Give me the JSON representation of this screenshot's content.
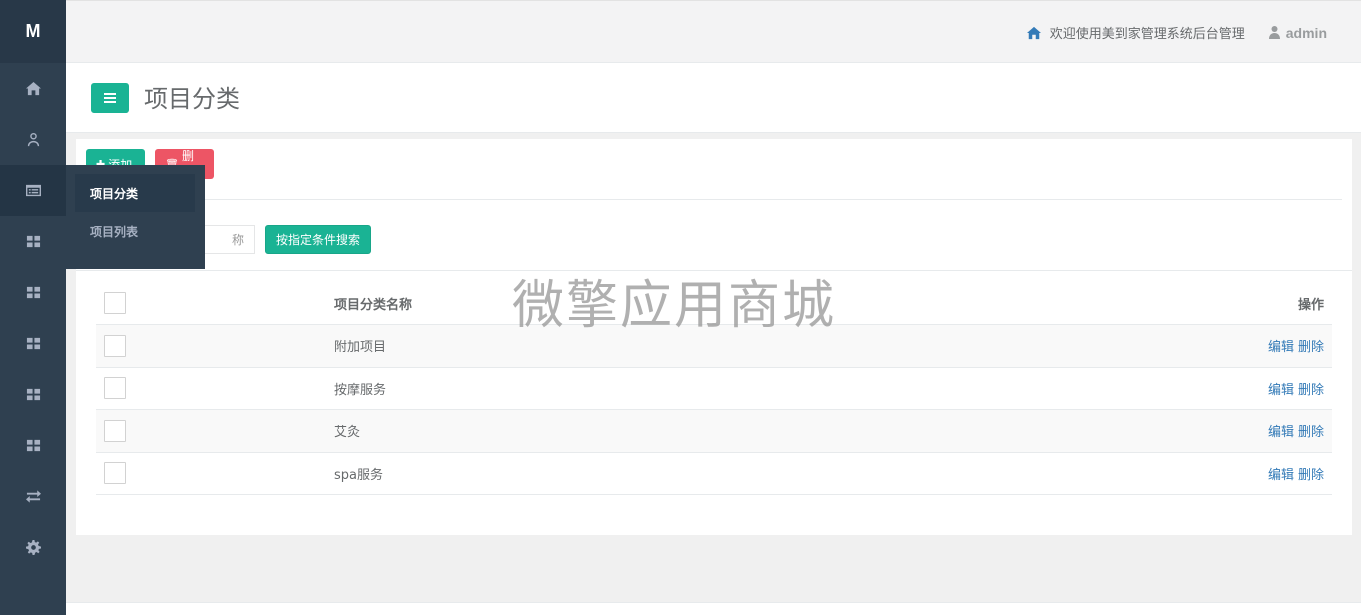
{
  "sidebar": {
    "logo": "M",
    "items": [
      {
        "icon": "home-icon"
      },
      {
        "icon": "user-icon"
      },
      {
        "icon": "list-icon",
        "active": true
      },
      {
        "icon": "grid-icon"
      },
      {
        "icon": "grid-icon"
      },
      {
        "icon": "grid-icon"
      },
      {
        "icon": "grid-icon"
      },
      {
        "icon": "grid-icon"
      },
      {
        "icon": "exchange-icon"
      },
      {
        "icon": "gear-icon"
      }
    ],
    "flyout": {
      "items": [
        {
          "label": "项目分类",
          "active": true
        },
        {
          "label": "项目列表"
        }
      ]
    }
  },
  "topbar": {
    "welcome": "欢迎使用美到家管理系统后台管理",
    "user": "admin"
  },
  "page": {
    "title": "项目分类"
  },
  "toolbar": {
    "add_label": "添加",
    "delete_label": "删除",
    "search_placeholder_visible": "称",
    "search_button": "按指定条件搜索"
  },
  "table": {
    "headers": {
      "name": "项目分类名称",
      "op": "操作"
    },
    "rows": [
      {
        "name": "附加项目",
        "edit": "编辑",
        "delete": "删除"
      },
      {
        "name": "按摩服务",
        "edit": "编辑",
        "delete": "删除"
      },
      {
        "name": "艾灸",
        "edit": "编辑",
        "delete": "删除"
      },
      {
        "name": "spa服务",
        "edit": "编辑",
        "delete": "删除"
      }
    ]
  },
  "watermark": "微擎应用商城",
  "colors": {
    "sidebar": "#2f4050",
    "primary": "#1ab394",
    "danger": "#ed5565",
    "link": "#337ab7"
  }
}
